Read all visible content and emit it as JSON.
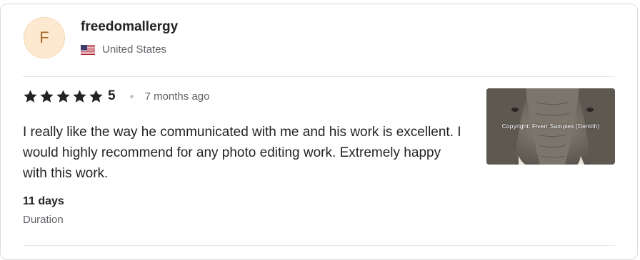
{
  "reviewer": {
    "initial": "F",
    "username": "freedomallergy",
    "country": "United States",
    "flag_icon": "us-flag-icon"
  },
  "review": {
    "rating": "5",
    "star_count": 5,
    "star_color": "#222325",
    "time_ago": "7 months ago",
    "text": "I really like the way he communicated with me and his work is excellent. I would highly recommend for any photo editing work. Extremely happy with this work."
  },
  "thumbnail": {
    "watermark": "Copyright: Fiverr Samples (Demith)"
  },
  "duration": {
    "value": "11 days",
    "label": "Duration"
  },
  "colors": {
    "avatar_bg": "#fde9d0",
    "text_primary": "#222325",
    "text_secondary": "#62646a",
    "divider": "#e4e5e7"
  }
}
